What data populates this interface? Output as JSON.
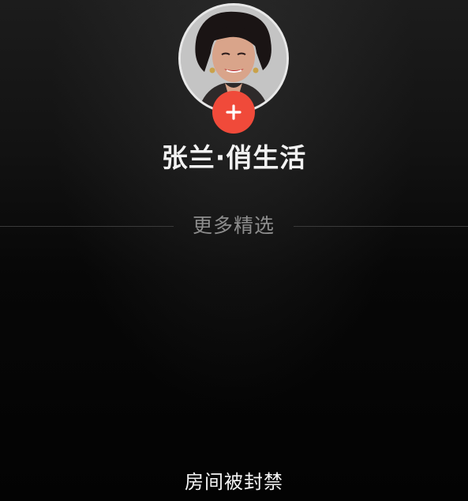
{
  "profile": {
    "name": "张兰·俏生活",
    "avatar_icon": "avatar-photo",
    "follow_icon": "plus-icon",
    "follow_color": "#f04a3a"
  },
  "divider": {
    "label": "更多精选"
  },
  "status": {
    "message": "房间被封禁"
  }
}
